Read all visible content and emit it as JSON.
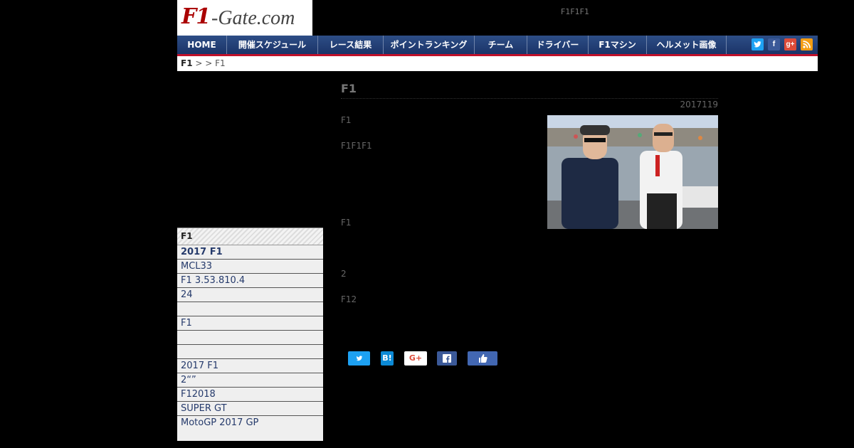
{
  "header": {
    "logo_mark": "F1",
    "logo_rest": "-Gate.com",
    "tagline": "F1F1F1"
  },
  "nav": {
    "items": [
      {
        "label": "HOME"
      },
      {
        "label": "開催スケジュール"
      },
      {
        "label": "レース結果"
      },
      {
        "label": "ポイントランキング"
      },
      {
        "label": "チーム"
      },
      {
        "label": "ドライバー"
      },
      {
        "label": "F1マシン"
      },
      {
        "label": "ヘルメット画像"
      }
    ],
    "social_icons": [
      "twitter-icon",
      "facebook-icon",
      "google-plus-icon",
      "rss-icon"
    ]
  },
  "breadcrumb": {
    "home": "F1",
    "sep1": " > ",
    "sep2": " > ",
    "current": "F1"
  },
  "sidebar": {
    "heading": "F1",
    "items": [
      {
        "label": "2017 F1",
        "bold": true
      },
      {
        "label": "MCL33"
      },
      {
        "label": "F1 3.53.810.4"
      },
      {
        "label": "24"
      },
      {
        "label": ""
      },
      {
        "label": "F1"
      },
      {
        "label": ""
      },
      {
        "label": ""
      },
      {
        "label": "2017 F1"
      },
      {
        "label": "2“”"
      },
      {
        "label": " F12018"
      },
      {
        "label": "SUPER GT"
      },
      {
        "label": "MotoGP 2017  GP"
      }
    ]
  },
  "article": {
    "title": "F1",
    "date": "2017119",
    "paragraphs": [
      "F1",
      "F1F1F1",
      "F1",
      "2",
      "F12"
    ]
  },
  "share": {
    "twitter": "",
    "hatena": "B!",
    "google": "G+",
    "facebook": "",
    "like": ""
  },
  "colors": {
    "nav_bg": "#1b3468",
    "nav_accent": "#c0102a",
    "logo_red": "#aa0000",
    "sidebar_text": "#253a6b"
  }
}
